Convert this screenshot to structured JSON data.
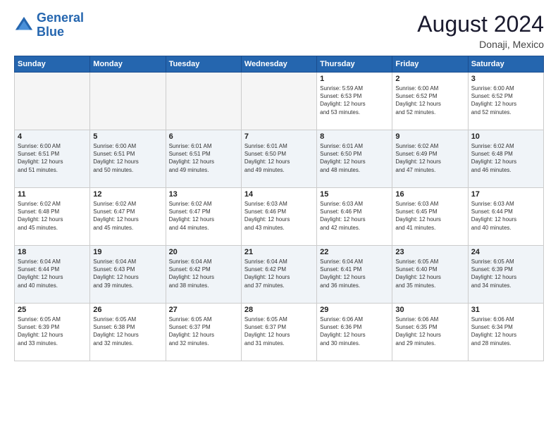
{
  "header": {
    "logo_line1": "General",
    "logo_line2": "Blue",
    "month_title": "August 2024",
    "location": "Donaji, Mexico"
  },
  "weekdays": [
    "Sunday",
    "Monday",
    "Tuesday",
    "Wednesday",
    "Thursday",
    "Friday",
    "Saturday"
  ],
  "weeks": [
    [
      {
        "day": "",
        "detail": ""
      },
      {
        "day": "",
        "detail": ""
      },
      {
        "day": "",
        "detail": ""
      },
      {
        "day": "",
        "detail": ""
      },
      {
        "day": "1",
        "detail": "Sunrise: 5:59 AM\nSunset: 6:53 PM\nDaylight: 12 hours\nand 53 minutes."
      },
      {
        "day": "2",
        "detail": "Sunrise: 6:00 AM\nSunset: 6:52 PM\nDaylight: 12 hours\nand 52 minutes."
      },
      {
        "day": "3",
        "detail": "Sunrise: 6:00 AM\nSunset: 6:52 PM\nDaylight: 12 hours\nand 52 minutes."
      }
    ],
    [
      {
        "day": "4",
        "detail": "Sunrise: 6:00 AM\nSunset: 6:51 PM\nDaylight: 12 hours\nand 51 minutes."
      },
      {
        "day": "5",
        "detail": "Sunrise: 6:00 AM\nSunset: 6:51 PM\nDaylight: 12 hours\nand 50 minutes."
      },
      {
        "day": "6",
        "detail": "Sunrise: 6:01 AM\nSunset: 6:51 PM\nDaylight: 12 hours\nand 49 minutes."
      },
      {
        "day": "7",
        "detail": "Sunrise: 6:01 AM\nSunset: 6:50 PM\nDaylight: 12 hours\nand 49 minutes."
      },
      {
        "day": "8",
        "detail": "Sunrise: 6:01 AM\nSunset: 6:50 PM\nDaylight: 12 hours\nand 48 minutes."
      },
      {
        "day": "9",
        "detail": "Sunrise: 6:02 AM\nSunset: 6:49 PM\nDaylight: 12 hours\nand 47 minutes."
      },
      {
        "day": "10",
        "detail": "Sunrise: 6:02 AM\nSunset: 6:48 PM\nDaylight: 12 hours\nand 46 minutes."
      }
    ],
    [
      {
        "day": "11",
        "detail": "Sunrise: 6:02 AM\nSunset: 6:48 PM\nDaylight: 12 hours\nand 45 minutes."
      },
      {
        "day": "12",
        "detail": "Sunrise: 6:02 AM\nSunset: 6:47 PM\nDaylight: 12 hours\nand 45 minutes."
      },
      {
        "day": "13",
        "detail": "Sunrise: 6:02 AM\nSunset: 6:47 PM\nDaylight: 12 hours\nand 44 minutes."
      },
      {
        "day": "14",
        "detail": "Sunrise: 6:03 AM\nSunset: 6:46 PM\nDaylight: 12 hours\nand 43 minutes."
      },
      {
        "day": "15",
        "detail": "Sunrise: 6:03 AM\nSunset: 6:46 PM\nDaylight: 12 hours\nand 42 minutes."
      },
      {
        "day": "16",
        "detail": "Sunrise: 6:03 AM\nSunset: 6:45 PM\nDaylight: 12 hours\nand 41 minutes."
      },
      {
        "day": "17",
        "detail": "Sunrise: 6:03 AM\nSunset: 6:44 PM\nDaylight: 12 hours\nand 40 minutes."
      }
    ],
    [
      {
        "day": "18",
        "detail": "Sunrise: 6:04 AM\nSunset: 6:44 PM\nDaylight: 12 hours\nand 40 minutes."
      },
      {
        "day": "19",
        "detail": "Sunrise: 6:04 AM\nSunset: 6:43 PM\nDaylight: 12 hours\nand 39 minutes."
      },
      {
        "day": "20",
        "detail": "Sunrise: 6:04 AM\nSunset: 6:42 PM\nDaylight: 12 hours\nand 38 minutes."
      },
      {
        "day": "21",
        "detail": "Sunrise: 6:04 AM\nSunset: 6:42 PM\nDaylight: 12 hours\nand 37 minutes."
      },
      {
        "day": "22",
        "detail": "Sunrise: 6:04 AM\nSunset: 6:41 PM\nDaylight: 12 hours\nand 36 minutes."
      },
      {
        "day": "23",
        "detail": "Sunrise: 6:05 AM\nSunset: 6:40 PM\nDaylight: 12 hours\nand 35 minutes."
      },
      {
        "day": "24",
        "detail": "Sunrise: 6:05 AM\nSunset: 6:39 PM\nDaylight: 12 hours\nand 34 minutes."
      }
    ],
    [
      {
        "day": "25",
        "detail": "Sunrise: 6:05 AM\nSunset: 6:39 PM\nDaylight: 12 hours\nand 33 minutes."
      },
      {
        "day": "26",
        "detail": "Sunrise: 6:05 AM\nSunset: 6:38 PM\nDaylight: 12 hours\nand 32 minutes."
      },
      {
        "day": "27",
        "detail": "Sunrise: 6:05 AM\nSunset: 6:37 PM\nDaylight: 12 hours\nand 32 minutes."
      },
      {
        "day": "28",
        "detail": "Sunrise: 6:05 AM\nSunset: 6:37 PM\nDaylight: 12 hours\nand 31 minutes."
      },
      {
        "day": "29",
        "detail": "Sunrise: 6:06 AM\nSunset: 6:36 PM\nDaylight: 12 hours\nand 30 minutes."
      },
      {
        "day": "30",
        "detail": "Sunrise: 6:06 AM\nSunset: 6:35 PM\nDaylight: 12 hours\nand 29 minutes."
      },
      {
        "day": "31",
        "detail": "Sunrise: 6:06 AM\nSunset: 6:34 PM\nDaylight: 12 hours\nand 28 minutes."
      }
    ]
  ]
}
